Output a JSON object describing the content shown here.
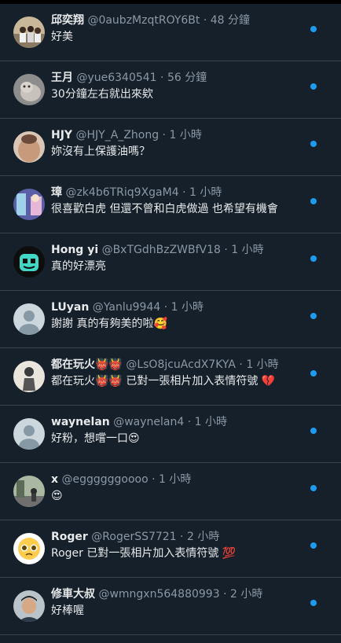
{
  "colors": {
    "background": "#15202b",
    "divider": "#38444d",
    "name": "#e7e9ea",
    "meta": "#8b98a5",
    "unread_dot": "#1d9bf0"
  },
  "notifications": [
    {
      "name": "邱奕翔",
      "handle": "@0aubzMzqtROY6Bt",
      "time": "48 分鐘",
      "text": "好美",
      "avatar_icon": "group-photo-avatar"
    },
    {
      "name": "王月",
      "handle": "@yue6340541",
      "time": "56 分鐘",
      "text": "30分鐘左右就出來欸",
      "avatar_icon": "cat-photo-avatar"
    },
    {
      "name": "HJY",
      "handle": "@HJY_A_Zhong",
      "time": "1 小時",
      "text": "妳沒有上保護油嗎？",
      "avatar_icon": "portrait-photo-avatar"
    },
    {
      "name": "璋",
      "handle": "@zk4b6TRiq9XgaM4",
      "time": "1 小時",
      "text": "很喜歡白虎 但還不曾和白虎做過 也希望有機會",
      "avatar_icon": "anime-photo-avatar"
    },
    {
      "name": "Hong yi",
      "handle": "@BxTGdhBzZWBfV18",
      "time": "1 小時",
      "text": "真的好漂亮",
      "avatar_icon": "mask-avatar"
    },
    {
      "name": "LUyan",
      "handle": "@Yanlu9944",
      "time": "1 小時",
      "text": "謝謝 真的有夠美的啦🥰",
      "avatar_icon": "default-avatar"
    },
    {
      "name": "都在玩火👹👹",
      "handle": "@LsO8jcuAcdX7KYA",
      "time": "1 小時",
      "text": "都在玩火👹👹 已對一張相片加入表情符號 💔",
      "avatar_icon": "sketch-avatar"
    },
    {
      "name": "waynelan",
      "handle": "@waynelan4",
      "time": "1 小時",
      "text": "好粉，想嚐一口😍",
      "avatar_icon": "default-avatar"
    },
    {
      "name": "x",
      "handle": "@eggggggoooo",
      "time": "1 小時",
      "text": "😍",
      "avatar_icon": "street-photo-avatar"
    },
    {
      "name": "Roger",
      "handle": "@RogerSS7721",
      "time": "2 小時",
      "text": "Roger 已對一張相片加入表情符號 💯",
      "avatar_icon": "pleading-emoji-avatar"
    },
    {
      "name": "修車大叔",
      "handle": "@wmngxn564880993",
      "time": "2 小時",
      "text": "好棒喔",
      "avatar_icon": "man-photo-avatar"
    }
  ]
}
